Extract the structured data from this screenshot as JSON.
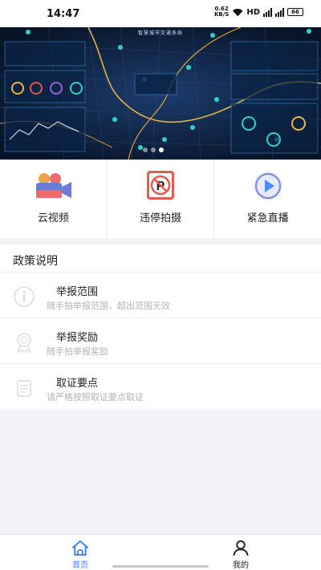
{
  "status_bar": {
    "time": "14:47",
    "net_speed_value": "0.62",
    "net_speed_unit": "KB/S",
    "hd": "HD",
    "battery": "66"
  },
  "banner": {
    "title": "智慧城市交通系统",
    "page_count": 3,
    "active_page": 3
  },
  "quick_actions": [
    {
      "label": "云视频",
      "icon": "video-camera-icon"
    },
    {
      "label": "违停拍摄",
      "icon": "no-parking-icon"
    },
    {
      "label": "紧急直播",
      "icon": "play-live-icon"
    }
  ],
  "policy": {
    "title": "政策说明",
    "items": [
      {
        "title": "举报范围",
        "desc": "随手拍举报范围，超出范围无效",
        "icon": "info-icon"
      },
      {
        "title": "举报奖励",
        "desc": "随手拍举报奖励",
        "icon": "award-ribbon-icon"
      },
      {
        "title": "取证要点",
        "desc": "请严格按照取证要点取证",
        "icon": "document-icon"
      }
    ]
  },
  "tabbar": {
    "items": [
      {
        "label": "首页",
        "icon": "home-icon",
        "active": true
      },
      {
        "label": "我的",
        "icon": "user-icon",
        "active": false
      }
    ],
    "active_color": "#3f7ef0"
  }
}
